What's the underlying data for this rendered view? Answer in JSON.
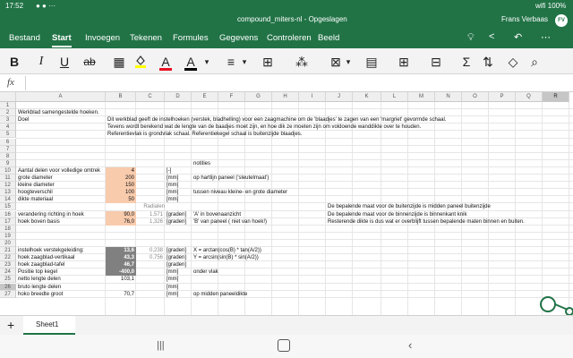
{
  "status": {
    "time": "17:52",
    "right_icons": "wifi 100%"
  },
  "window": {
    "title": "compound_miters-nl - Opgeslagen",
    "user": "Frans Verbaas",
    "user_initials": "FV"
  },
  "menu": {
    "tabs": [
      "Bestand",
      "Start",
      "Invoegen",
      "Tekenen",
      "Formules",
      "Gegevens",
      "Controleren",
      "Beeld"
    ],
    "active": "Start"
  },
  "ribbon": {
    "bold": "B",
    "italic": "I",
    "underline": "U",
    "strike": "ab",
    "font_color_a": "A",
    "text_color_a": "A"
  },
  "formula": {
    "fx": "fx"
  },
  "columns": [
    "A",
    "B",
    "C",
    "D",
    "E",
    "F",
    "G",
    "H",
    "I",
    "J",
    "K",
    "L",
    "M",
    "N",
    "O",
    "P",
    "Q",
    "R"
  ],
  "rows": [
    "1",
    "2",
    "3",
    "4",
    "5",
    "6",
    "7",
    "8",
    "9",
    "10",
    "11",
    "12",
    "13",
    "14",
    "15",
    "16",
    "17",
    "18",
    "19",
    "20",
    "21",
    "22",
    "23",
    "24",
    "25",
    "26",
    "27"
  ],
  "cells": {
    "A2": "Werkblad samengestelde hoeken.",
    "A3": "Doel",
    "B3": "Dit werkblad geeft de instelhoeken (verstek, bladhelling) voor een zaagmachine om de 'blaadjes' te zagen van een 'margriet' gevormde schaal.",
    "B4": "Tevens wordt berekend wat de lengte van de baadjes moet zijn, en hoe dik ze moeten zijn om voldoende wanddikte over te houden.",
    "B5": "Referentievlak is grondvlak schaal. Referentiekegel schaal is buitenzijde blaadjes.",
    "E9": "notities",
    "A10": "Aantal delen voor volledige omtrek",
    "B10": "4",
    "D10": "[-]",
    "A11": "grote diameter",
    "B11": "200",
    "D11": "[mm]",
    "E11": "op hartlijn paneel ('sleutelmaat')",
    "A12": "kleine diameter",
    "B12": "150",
    "D12": "[mm]",
    "A13": "hoogteverschil",
    "B13": "100",
    "D13": "[mm]",
    "E13": "tussen niveau kleine- en grote diameter",
    "A14": "dikte materiaal",
    "B14": "50",
    "D14": "[mm]",
    "C15": "Radialen",
    "J15": "De bepalende maat voor de buitenzijde is midden paneel buitenzijde",
    "A16": "verandering richting in hoek",
    "B16": "90,0",
    "C16": "1,571",
    "D16": "[graden]",
    "E16": "'A' in bovenaanzicht",
    "J16": "De bepalende maat voor de binnenzijde is binnenkant knik",
    "A17": "hoek boven basis",
    "B17": "76,0",
    "C17": "1,326",
    "D17": "[graden]",
    "E17": "'B' van paneel ( niet van hoek!)",
    "J17": "Resterende dikte is dus wat er overblijft tussen bepalende maten binnen en buiten.",
    "A21": "instelhoek verstekgeleiding:",
    "B21": "13,6",
    "C21": "0,238",
    "D21": "[graden]",
    "E21": "X = arctan(cos(B) * tan(A/2))",
    "A22": "hoek zaagblad-vertikaal",
    "B22": "43,3",
    "C22": "0,756",
    "D22": "[graden]",
    "E22": "Y = arcsin(sin(B) * sin(A/2))",
    "A23": "hoek zaagblad-tafel",
    "B23": "46,7",
    "D23": "[graden]",
    "A24": "Positie top kegel",
    "B24": "-400,0",
    "D24": "[mm]",
    "E24": "onder vlak",
    "A25": "netto lengte delen",
    "B25": "103,1",
    "D25": "[mm]",
    "A26": "bruto lengte delen",
    "D26": "[mm]",
    "A27": "hoko breedte groot",
    "B27": "70,7",
    "D27": "[mm]",
    "E27": "op midden paneeldikte"
  },
  "sheet": {
    "add": "+",
    "tab": "Sheet1"
  },
  "colors": {
    "excel_green": "#217346",
    "input_fill": "#f8cbad",
    "result_fill": "#808080"
  }
}
